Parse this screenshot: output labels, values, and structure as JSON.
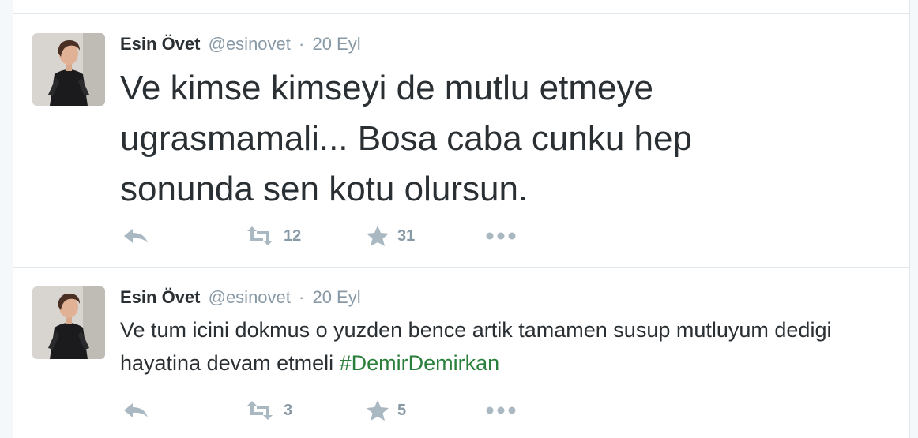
{
  "tweets": [
    {
      "name": "Esin Övet",
      "handle": "@esinovet",
      "separator": "·",
      "time": "20 Eyl",
      "text": "Ve kimse kimseyi de mutlu etmeye ugrasmamali... Bosa caba cunku hep sonunda sen kotu olursun.",
      "hashtag": "",
      "retweets": "12",
      "favorites": "31"
    },
    {
      "name": "Esin Övet",
      "handle": "@esinovet",
      "separator": "·",
      "time": "20 Eyl",
      "text": "Ve tum icini dokmus o yuzden bence artik tamamen susup mutluyum dedigi hayatina devam etmeli ",
      "hashtag": "#DemirDemirkan",
      "retweets": "3",
      "favorites": "5"
    }
  ],
  "colors": {
    "text": "#292f33",
    "muted": "#8899a6",
    "icon": "#aab8c2",
    "hashtag": "#2b7f3c",
    "border": "#e1e8ed"
  },
  "icons": {
    "reply": "reply-icon",
    "retweet": "retweet-icon",
    "favorite": "star-icon",
    "more": "more-icon"
  }
}
